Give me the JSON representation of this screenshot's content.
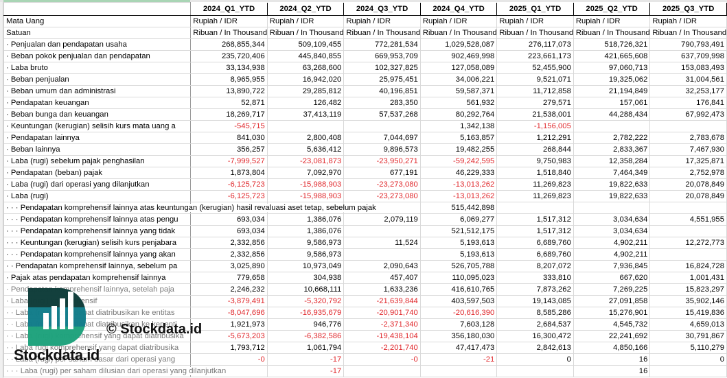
{
  "columns": [
    "2024_Q1_YTD",
    "2024_Q2_YTD",
    "2024_Q3_YTD",
    "2024_Q4_YTD",
    "2025_Q1_YTD",
    "2025_Q2_YTD",
    "2025_Q3_YTD"
  ],
  "currency": {
    "label": "Mata Uang",
    "value": "Rupiah / IDR"
  },
  "unit": {
    "label": "Satuan",
    "value": "Ribuan / In Thousands"
  },
  "rows": [
    {
      "label": "· Penjualan dan pendapatan usaha",
      "values": [
        "268,855,344",
        "509,109,455",
        "772,281,534",
        "1,029,528,087",
        "276,117,073",
        "518,726,321",
        "790,793,491"
      ]
    },
    {
      "label": "· Beban pokok penjualan dan pendapatan",
      "values": [
        "235,720,406",
        "445,840,855",
        "669,953,709",
        "902,469,998",
        "223,661,173",
        "421,665,608",
        "637,709,998"
      ]
    },
    {
      "label": "· Laba bruto",
      "values": [
        "33,134,938",
        "63,268,600",
        "102,327,825",
        "127,058,089",
        "52,455,900",
        "97,060,713",
        "153,083,493"
      ]
    },
    {
      "label": "· Beban penjualan",
      "values": [
        "8,965,955",
        "16,942,020",
        "25,975,451",
        "34,006,221",
        "9,521,071",
        "19,325,062",
        "31,004,561"
      ]
    },
    {
      "label": "· Beban umum dan administrasi",
      "values": [
        "13,890,722",
        "29,285,812",
        "40,196,851",
        "59,587,371",
        "11,712,858",
        "21,194,849",
        "32,253,177"
      ]
    },
    {
      "label": "· Pendapatan keuangan",
      "values": [
        "52,871",
        "126,482",
        "283,350",
        "561,932",
        "279,571",
        "157,061",
        "176,841"
      ]
    },
    {
      "label": "· Beban bunga dan keuangan",
      "values": [
        "18,269,717",
        "37,413,119",
        "57,537,268",
        "80,292,764",
        "21,538,001",
        "44,288,434",
        "67,992,473"
      ]
    },
    {
      "label": "· Keuntungan (kerugian) selisih kurs mata uang a",
      "values": [
        "-545,715",
        "",
        "",
        "1,342,138",
        "-1,156,005",
        "",
        ""
      ]
    },
    {
      "label": "· Pendapatan lainnya",
      "values": [
        "841,030",
        "2,800,408",
        "7,044,697",
        "5,163,857",
        "1,212,291",
        "2,782,222",
        "2,783,678"
      ]
    },
    {
      "label": "· Beban lainnya",
      "values": [
        "356,257",
        "5,636,412",
        "9,896,573",
        "19,482,255",
        "268,844",
        "2,833,367",
        "7,467,930"
      ]
    },
    {
      "label": "· Laba (rugi) sebelum pajak penghasilan",
      "values": [
        "-7,999,527",
        "-23,081,873",
        "-23,950,271",
        "-59,242,595",
        "9,750,983",
        "12,358,284",
        "17,325,871"
      ]
    },
    {
      "label": "· Pendapatan (beban) pajak",
      "values": [
        "1,873,804",
        "7,092,970",
        "677,191",
        "46,229,333",
        "1,518,840",
        "7,464,349",
        "2,752,978"
      ]
    },
    {
      "label": "· Laba (rugi) dari operasi yang dilanjutkan",
      "values": [
        "-6,125,723",
        "-15,988,903",
        "-23,273,080",
        "-13,013,262",
        "11,269,823",
        "19,822,633",
        "20,078,849"
      ]
    },
    {
      "label": "· Laba (rugi)",
      "values": [
        "-6,125,723",
        "-15,988,903",
        "-23,273,080",
        "-13,013,262",
        "11,269,823",
        "19,822,633",
        "20,078,849"
      ]
    },
    {
      "label": "· · · Pendapatan komprehensif lainnya atas keuntungan (kerugian) hasil revaluasi aset tetap, sebelum pajak",
      "values": [
        "",
        "",
        "",
        "515,442,898",
        "",
        "",
        ""
      ]
    },
    {
      "label": "· · · Pendapatan komprehensif lainnya atas pengu",
      "values": [
        "693,034",
        "1,386,076",
        "2,079,119",
        "6,069,277",
        "1,517,312",
        "3,034,634",
        "4,551,955"
      ]
    },
    {
      "label": "· · · Pendapatan komprehensif lainnya yang tidak",
      "values": [
        "693,034",
        "1,386,076",
        "",
        "521,512,175",
        "1,517,312",
        "3,034,634",
        ""
      ]
    },
    {
      "label": "· · · Keuntungan (kerugian) selisih kurs penjabara",
      "values": [
        "2,332,856",
        "9,586,973",
        "11,524",
        "5,193,613",
        "6,689,760",
        "4,902,211",
        "12,272,773"
      ]
    },
    {
      "label": "· · · Pendapatan komprehensif lainnya yang akan",
      "values": [
        "2,332,856",
        "9,586,973",
        "",
        "5,193,613",
        "6,689,760",
        "4,902,211",
        ""
      ]
    },
    {
      "label": "· · Pendapatan komprehensif lainnya, sebelum pa",
      "values": [
        "3,025,890",
        "10,973,049",
        "2,090,643",
        "526,705,788",
        "8,207,072",
        "7,936,845",
        "16,824,728"
      ]
    },
    {
      "label": "· Pajak atas pendapatan komprehensif lainnya",
      "values": [
        "779,658",
        "304,938",
        "457,407",
        "110,095,023",
        "333,810",
        "667,620",
        "1,001,431"
      ]
    },
    {
      "label": "· Pendapatan komprehensif lainnya, setelah paja",
      "values": [
        "2,246,232",
        "10,668,111",
        "1,633,236",
        "416,610,765",
        "7,873,262",
        "7,269,225",
        "15,823,297"
      ]
    },
    {
      "label": "· Laba (rugi) komprehensif",
      "values": [
        "-3,879,491",
        "-5,320,792",
        "-21,639,844",
        "403,597,503",
        "19,143,085",
        "27,091,858",
        "35,902,146"
      ]
    },
    {
      "label": "· · Laba (rugi) yang dapat diatribusikan ke entitas",
      "values": [
        "-8,047,696",
        "-16,935,679",
        "-20,901,740",
        "-20,616,390",
        "8,585,286",
        "15,276,901",
        "15,419,836"
      ]
    },
    {
      "label": "· · Laba (rugi) yang dapat diatribusikan ke kepenti",
      "values": [
        "1,921,973",
        "946,776",
        "-2,371,340",
        "7,603,128",
        "2,684,537",
        "4,545,732",
        "4,659,013"
      ]
    },
    {
      "label": "· · Laba (rugi) komprehensif yang dapat diatribusika",
      "values": [
        "-5,673,203",
        "-6,382,586",
        "-19,438,104",
        "356,180,030",
        "16,300,472",
        "22,241,692",
        "30,791,867"
      ]
    },
    {
      "label": "· · Laba rugi komprehensif yang dapat diatribusika",
      "values": [
        "1,793,712",
        "1,061,794",
        "-2,201,740",
        "47,417,473",
        "2,842,613",
        "4,850,166",
        "5,110,279"
      ]
    },
    {
      "label": "· · Laba (rugi) per saham dasar dari operasi yang",
      "values": [
        "-0",
        "-17",
        "-0",
        "-21",
        "0",
        "16",
        "0"
      ]
    },
    {
      "label": "· · · Laba (rugi) per saham dilusian dari operasi yang dilanjutkan",
      "values": [
        "",
        "-17",
        "",
        "",
        "",
        "16",
        ""
      ]
    }
  ],
  "watermark": {
    "copyright": "© Stockdata.id",
    "brand": "Stockdata.id"
  },
  "colors": {
    "negative": "#e0262a",
    "logo_dark": "#0f3d3a",
    "logo_teal": "#127d8a",
    "logo_green": "#1fa37d"
  }
}
